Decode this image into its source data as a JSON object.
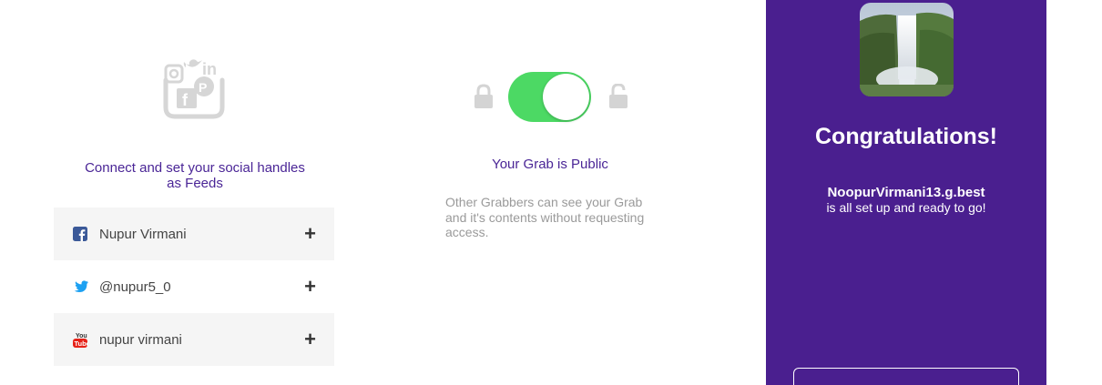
{
  "social": {
    "hero_icon": "social-bucket-icon",
    "title": "Connect and set your social handles as Feeds",
    "handles": [
      {
        "network": "facebook",
        "icon": "facebook-icon",
        "label": "Nupur Virmani",
        "action_icon": "plus-icon"
      },
      {
        "network": "twitter",
        "icon": "twitter-icon",
        "label": "@nupur5_0",
        "action_icon": "plus-icon"
      },
      {
        "network": "youtube",
        "icon": "youtube-icon",
        "label": "nupur virmani",
        "action_icon": "plus-icon"
      }
    ]
  },
  "privacy": {
    "toggle_on": true,
    "title": "Your Grab is Public",
    "description": "Other Grabbers can see your Grab and it's contents without requesting access."
  },
  "congrats": {
    "title": "Congratulations!",
    "handle": "NoopurVirmani13.g.best",
    "message": "is all set up and ready to go!",
    "button_label": ""
  },
  "colors": {
    "brand_purple": "#4a1f8f",
    "title_purple": "#4a2596",
    "toggle_green": "#4cd964",
    "facebook": "#3b5998",
    "twitter": "#1da1f2",
    "youtube": "#e62117"
  }
}
